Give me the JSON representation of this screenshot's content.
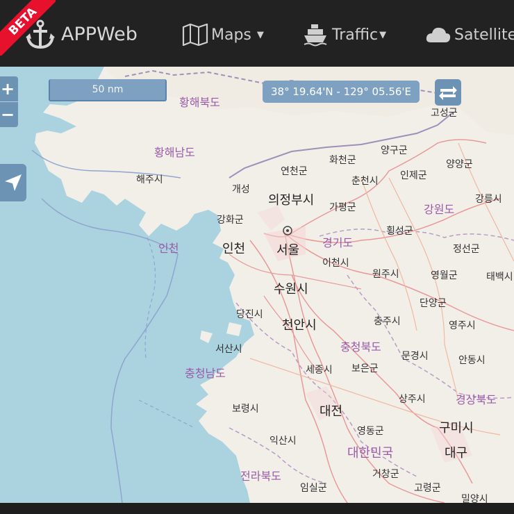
{
  "navbar": {
    "beta": "BETA",
    "brand": "APPWeb",
    "maps_label": "Maps",
    "traffic_label": "Traffic",
    "satellite_label": "Satellite"
  },
  "map": {
    "zoom_in": "+",
    "zoom_out": "−",
    "scale_label": "50 nm",
    "coordinates": "38° 19.64'N - 129° 05.56'E"
  },
  "labels": {
    "hwanghaebukdo": "황해북도",
    "hwanghaenamdo": "황해남도",
    "haeju": "해주시",
    "gaeseong": "개성",
    "ganghwa": "강화군",
    "incheon_sea": "인천",
    "incheon": "인천",
    "seoul": "서울",
    "uijeongbu": "의정부시",
    "yeoncheon": "연천군",
    "hwacheon": "화천군",
    "yanggu": "양구군",
    "goseong": "고성군",
    "yangyang": "양양군",
    "inje": "인제군",
    "chuncheon": "춘천시",
    "gapyeong": "가평군",
    "gangwondo": "강원도",
    "gangneung": "강릉시",
    "hoengseong": "횡성군",
    "gyeonggido": "경기도",
    "jeongseon": "정선군",
    "icheon": "이천시",
    "wonju": "원주시",
    "yeongwol": "영월군",
    "taebaek": "태백시",
    "suwon": "수원시",
    "danyang": "단양군",
    "dangjin": "당진시",
    "cheonan": "천안시",
    "chungju": "충주시",
    "yeongju": "영주시",
    "seosan": "서산시",
    "chungcheongbukdo": "충청북도",
    "mungyeong": "문경시",
    "andong": "안동시",
    "chungcheongnamdo": "충청남도",
    "sejong": "세종시",
    "boeun": "보은군",
    "sangju": "상주시",
    "gyeongsangbukdo": "경상북도",
    "boryeong": "보령시",
    "daejeon": "대전",
    "yeongdong": "영동군",
    "gumi": "구미시",
    "iksan": "익산시",
    "daehanminguk": "대한민국",
    "daegu": "대구",
    "jeollabukdo": "전라북도",
    "geochang": "거창군",
    "goryeong": "고령군",
    "imsil": "임실군",
    "miryang": "밀양시"
  }
}
